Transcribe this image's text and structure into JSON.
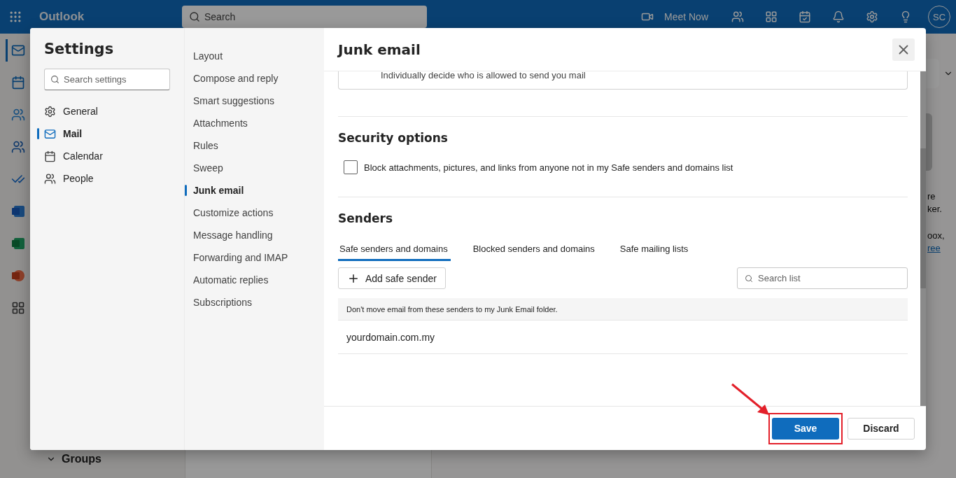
{
  "app_bar": {
    "app_name": "Outlook",
    "search": {
      "placeholder": "Search"
    },
    "meet_now": "Meet Now",
    "avatar": "SC"
  },
  "rail": [
    {
      "kind": "mail",
      "selected": true
    },
    {
      "kind": "calendar",
      "selected": false
    },
    {
      "kind": "people",
      "selected": false
    },
    {
      "kind": "groups",
      "selected": false
    },
    {
      "kind": "todo",
      "selected": false
    },
    {
      "kind": "word",
      "selected": false
    },
    {
      "kind": "excel",
      "selected": false
    },
    {
      "kind": "powerpoint",
      "selected": false
    },
    {
      "kind": "apps",
      "selected": false
    }
  ],
  "folder_pane": {
    "groups": "Groups"
  },
  "reading_pane": {
    "lines": [
      {
        "text": "re",
        "kind": "text"
      },
      {
        "text": "ker.",
        "kind": "text"
      },
      {
        "text": "oox,",
        "kind": "text"
      },
      {
        "text": "ree",
        "kind": "link"
      }
    ]
  },
  "settings": {
    "title": "Settings",
    "search": {
      "placeholder": "Search settings"
    },
    "categories": [
      {
        "label": "General",
        "kind": "gear",
        "selected": false
      },
      {
        "label": "Mail",
        "kind": "mail",
        "selected": true
      },
      {
        "label": "Calendar",
        "kind": "calendar",
        "selected": false
      },
      {
        "label": "People",
        "kind": "people",
        "selected": false
      }
    ],
    "subcategories": [
      {
        "label": "Layout",
        "selected": false
      },
      {
        "label": "Compose and reply",
        "selected": false
      },
      {
        "label": "Smart suggestions",
        "selected": false
      },
      {
        "label": "Attachments",
        "selected": false
      },
      {
        "label": "Rules",
        "selected": false
      },
      {
        "label": "Sweep",
        "selected": false
      },
      {
        "label": "Junk email",
        "selected": true
      },
      {
        "label": "Customize actions",
        "selected": false
      },
      {
        "label": "Message handling",
        "selected": false
      },
      {
        "label": "Forwarding and IMAP",
        "selected": false
      },
      {
        "label": "Automatic replies",
        "selected": false
      },
      {
        "label": "Subscriptions",
        "selected": false
      }
    ],
    "panel": {
      "title": "Junk email",
      "option_description": "Individually decide who is allowed to send you mail",
      "security": {
        "heading": "Security options",
        "checkbox": {
          "label": "Block attachments, pictures, and links from anyone not in my Safe senders and domains list",
          "checked": false
        }
      },
      "senders": {
        "heading": "Senders",
        "tabs": [
          {
            "label": "Safe senders and domains",
            "selected": true
          },
          {
            "label": "Blocked senders and domains",
            "selected": false
          },
          {
            "label": "Safe mailing lists",
            "selected": false
          }
        ],
        "add_button": "Add safe sender",
        "search": {
          "placeholder": "Search list"
        },
        "info": "Don't move email from these senders to my Junk Email folder.",
        "entries": [
          "yourdomain.com.my"
        ]
      },
      "buttons": {
        "save": "Save",
        "discard": "Discard"
      }
    }
  }
}
